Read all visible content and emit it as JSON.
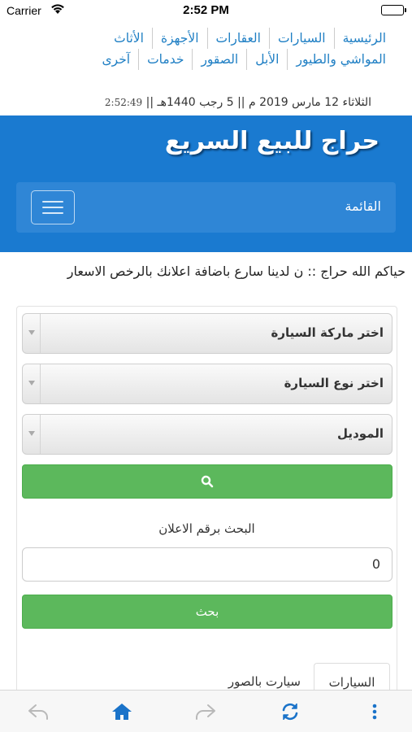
{
  "status_bar": {
    "carrier": "Carrier",
    "time": "2:52 PM"
  },
  "top_nav": {
    "row1": [
      "الرئيسية",
      "السيارات",
      "العقارات",
      "الأجهزة",
      "الأثاث"
    ],
    "row2": [
      "المواشي والطيور",
      "الأبل",
      "الصقور",
      "خدمات",
      "آخرى"
    ]
  },
  "dateline": {
    "date_text": "الثلاثاء 12 مارس 2019 م || 5 رجب 1440هـ ||",
    "clock": "2:52:49"
  },
  "header": {
    "site_title": "حراج للبيع السريع",
    "menu_label": "القائمة"
  },
  "marquee": {
    "text": "حياكم الله حراج   ::   ن لدينا سارع باضافة اعلانك بالرخص الاسعار"
  },
  "search_form": {
    "brand_select": "اختر ماركة السيارة",
    "type_select": "اختر نوع السيارة",
    "model_select": "الموديل",
    "search_by_number_label": "البحث برقم الاعلان",
    "ad_number_value": "0",
    "search_button": "بحث"
  },
  "tabs": {
    "cars": "السيارات",
    "cars_with_photos": "سيارت بالصور"
  },
  "colors": {
    "header_blue": "#1a7ad0",
    "link_blue": "#1f7fc4",
    "button_green": "#5cb85c"
  },
  "toolbar_icons": [
    "back-arrow-icon",
    "home-icon",
    "forward-arrow-icon",
    "refresh-icon",
    "more-vertical-icon"
  ]
}
